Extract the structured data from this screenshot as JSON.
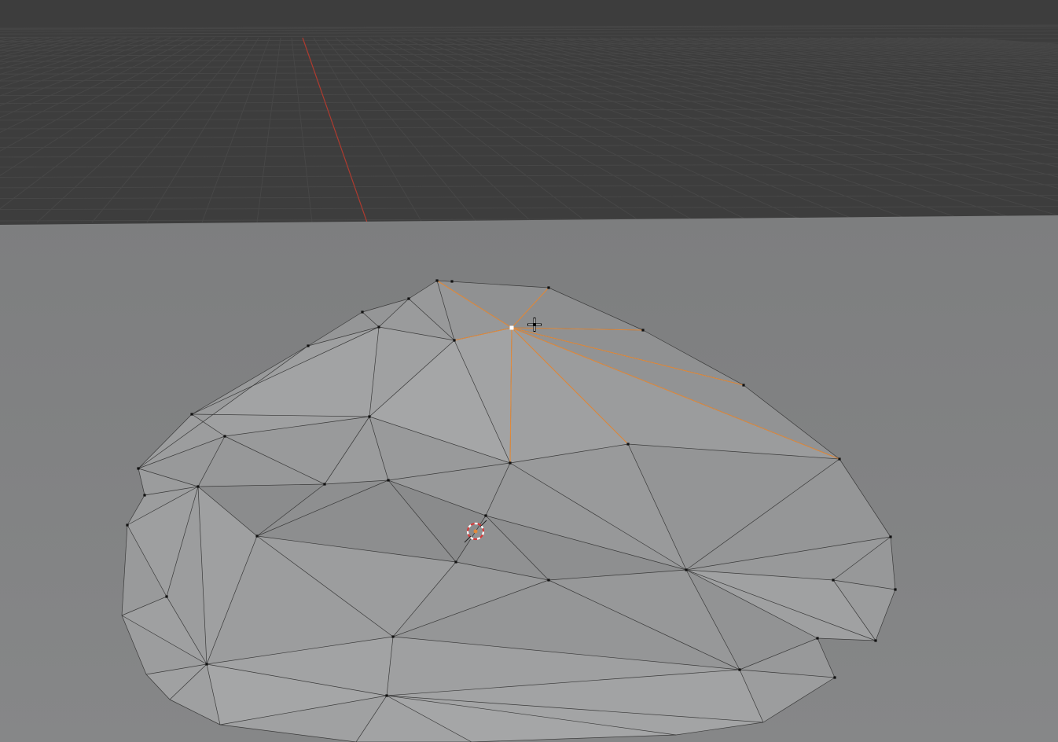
{
  "viewport": {
    "mode": "edit-mode",
    "object_type": "mesh",
    "selected_vertex_count": 1
  },
  "colors": {
    "background_dark": "#3d3d3d",
    "grid_line": "#484848",
    "x_axis": "#c0392b",
    "ground_plane": "#7e7f80",
    "mesh_edge": "#3a3a3a",
    "selection": "#e08a3c",
    "selected_vertex": "#ffffff",
    "vertex": "#111111"
  },
  "icons": [
    "3d-cursor-icon",
    "mouse-crosshair-icon"
  ]
}
